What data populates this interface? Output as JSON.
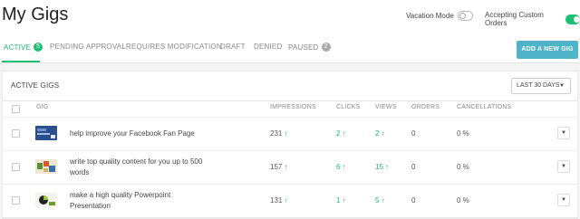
{
  "page": {
    "title": "My Gigs"
  },
  "toggles": {
    "vacation_label": "Vacation Mode",
    "vacation_on": false,
    "custom_orders_label": "Accepting Custom Orders",
    "custom_orders_on": true
  },
  "tabs": [
    {
      "label": "ACTIVE",
      "count": "5",
      "active": true
    },
    {
      "label": "PENDING APPROVAL",
      "count": "",
      "active": false
    },
    {
      "label": "REQUIRES MODIFICATION",
      "count": "",
      "active": false
    },
    {
      "label": "DRAFT",
      "count": "",
      "active": false
    },
    {
      "label": "DENIED",
      "count": "",
      "active": false
    },
    {
      "label": "PAUSED",
      "count": "2",
      "active": false
    }
  ],
  "add_button_label": "ADD A NEW GIG",
  "panel": {
    "title": "ACTIVE GIGS",
    "range_label": "LAST 30 DAYS",
    "columns": [
      "GIG",
      "IMPRESSIONS",
      "CLICKS",
      "VIEWS",
      "ORDERS",
      "CANCELLATIONS"
    ]
  },
  "rows": [
    {
      "title": "help improve your Facebook Fan Page",
      "impressions": "231",
      "clicks": "2",
      "views": "2",
      "orders": "0",
      "cancellations": "0 %"
    },
    {
      "title": "write top quality content for you up to 500 words",
      "impressions": "157",
      "clicks": "6",
      "views": "15",
      "orders": "0",
      "cancellations": "0 %"
    },
    {
      "title": "make a high quality Powerpoint Presentation",
      "impressions": "131",
      "clicks": "1",
      "views": "5",
      "orders": "0",
      "cancellations": "0 %"
    }
  ],
  "icons": {
    "up_arrow": "↑",
    "caret": "▼"
  },
  "colors": {
    "accent_green": "#1dbf73",
    "button_teal": "#4fb4c7"
  }
}
